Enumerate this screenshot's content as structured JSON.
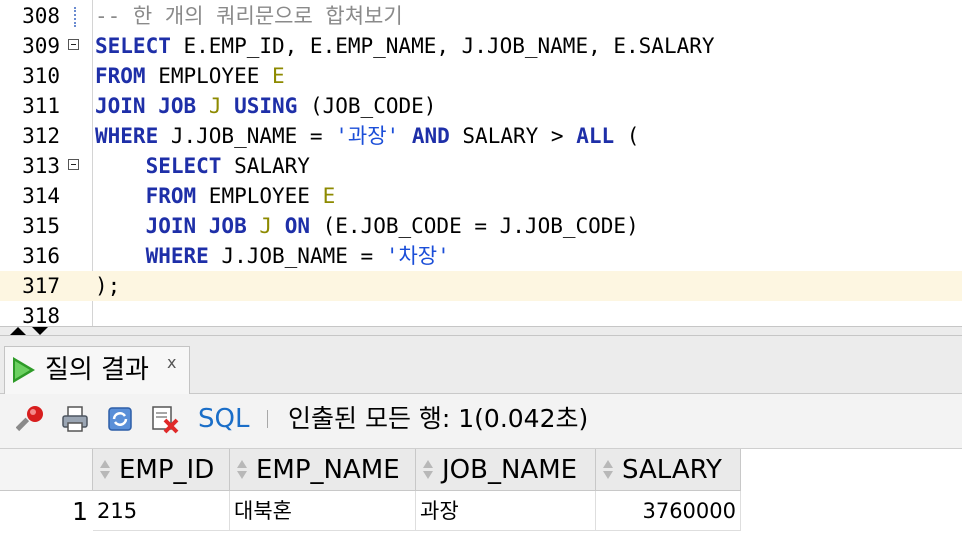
{
  "editor": {
    "lines": [
      {
        "num": "308",
        "fold": false,
        "current": false,
        "tokens": [
          {
            "t": "cmt",
            "v": "-- 한 개의 쿼리문으로 합쳐보기"
          }
        ]
      },
      {
        "num": "309",
        "fold": true,
        "current": false,
        "tokens": [
          {
            "t": "kw",
            "v": "SELECT"
          },
          {
            "t": "txt",
            "v": " E.EMP_ID, E.EMP_NAME, J.JOB_NAME, E.SALARY"
          }
        ]
      },
      {
        "num": "310",
        "fold": false,
        "current": false,
        "tokens": [
          {
            "t": "kw",
            "v": "FROM"
          },
          {
            "t": "txt",
            "v": " EMPLOYEE "
          },
          {
            "t": "al",
            "v": "E"
          }
        ]
      },
      {
        "num": "311",
        "fold": false,
        "current": false,
        "tokens": [
          {
            "t": "kw",
            "v": "JOIN JOB"
          },
          {
            "t": "txt",
            "v": " "
          },
          {
            "t": "al",
            "v": "J"
          },
          {
            "t": "txt",
            "v": " "
          },
          {
            "t": "kw",
            "v": "USING"
          },
          {
            "t": "txt",
            "v": " (JOB_CODE)"
          }
        ]
      },
      {
        "num": "312",
        "fold": false,
        "current": false,
        "tokens": [
          {
            "t": "kw",
            "v": "WHERE"
          },
          {
            "t": "txt",
            "v": " J.JOB_NAME = "
          },
          {
            "t": "str",
            "v": "'과장'"
          },
          {
            "t": "txt",
            "v": " "
          },
          {
            "t": "kw",
            "v": "AND"
          },
          {
            "t": "txt",
            "v": " SALARY > "
          },
          {
            "t": "kw",
            "v": "ALL"
          },
          {
            "t": "txt",
            "v": " ("
          }
        ]
      },
      {
        "num": "313",
        "fold": true,
        "current": false,
        "tokens": [
          {
            "t": "txt",
            "v": "    "
          },
          {
            "t": "kw",
            "v": "SELECT"
          },
          {
            "t": "txt",
            "v": " SALARY"
          }
        ]
      },
      {
        "num": "314",
        "fold": false,
        "current": false,
        "tokens": [
          {
            "t": "txt",
            "v": "    "
          },
          {
            "t": "kw",
            "v": "FROM"
          },
          {
            "t": "txt",
            "v": " EMPLOYEE "
          },
          {
            "t": "al",
            "v": "E"
          }
        ]
      },
      {
        "num": "315",
        "fold": false,
        "current": false,
        "tokens": [
          {
            "t": "txt",
            "v": "    "
          },
          {
            "t": "kw",
            "v": "JOIN JOB"
          },
          {
            "t": "txt",
            "v": " "
          },
          {
            "t": "al",
            "v": "J"
          },
          {
            "t": "txt",
            "v": " "
          },
          {
            "t": "kw",
            "v": "ON"
          },
          {
            "t": "txt",
            "v": " (E.JOB_CODE = J.JOB_CODE)"
          }
        ]
      },
      {
        "num": "316",
        "fold": false,
        "current": false,
        "tokens": [
          {
            "t": "txt",
            "v": "    "
          },
          {
            "t": "kw",
            "v": "WHERE"
          },
          {
            "t": "txt",
            "v": " J.JOB_NAME = "
          },
          {
            "t": "str",
            "v": "'차장'"
          }
        ]
      },
      {
        "num": "317",
        "fold": false,
        "current": true,
        "tokens": [
          {
            "t": "txt",
            "v": ");"
          }
        ]
      },
      {
        "num": "318",
        "fold": false,
        "current": false,
        "tokens": []
      }
    ]
  },
  "colors": {
    "keyword": "#1e2fa8",
    "alias": "#8d8a00",
    "string": "#1b4ed8",
    "comment": "#8a8a8a",
    "current_line": "#fdf6e1"
  },
  "results": {
    "tab_label": "질의 결과",
    "tab_close": "x",
    "toolbar": {
      "pin_icon": "pin-icon",
      "print_icon": "print-icon",
      "refresh_icon": "refresh-icon",
      "cancel_icon": "cancel-query-icon",
      "sql_label": "SQL",
      "status": "인출된 모든 행: 1(0.042초)"
    },
    "columns": [
      "EMP_ID",
      "EMP_NAME",
      "JOB_NAME",
      "SALARY"
    ],
    "rows": [
      {
        "num": "1",
        "cells": [
          "215",
          "대북혼",
          "과장",
          "3760000"
        ]
      }
    ]
  }
}
